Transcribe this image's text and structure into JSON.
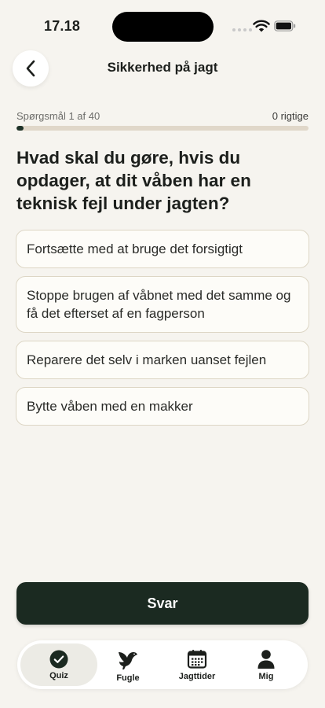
{
  "status_bar": {
    "time": "17.18"
  },
  "header": {
    "title": "Sikkerhed på jagt"
  },
  "progress": {
    "label": "Spørgsmål 1 af 40",
    "score": "0 rigtige",
    "fraction": 0.025
  },
  "question": {
    "text": "Hvad skal du gøre, hvis du opdager, at dit våben har en teknisk fejl under jagten?"
  },
  "answers": [
    {
      "label": "Fortsætte med at bruge det forsigtigt"
    },
    {
      "label": "Stoppe brugen af våbnet med det samme og få det efterset af en fagperson"
    },
    {
      "label": "Reparere det selv i marken uanset fejlen"
    },
    {
      "label": "Bytte våben med en makker"
    }
  ],
  "submit": {
    "label": "Svar"
  },
  "tabs": [
    {
      "label": "Quiz",
      "icon": "check-circle-icon",
      "active": true
    },
    {
      "label": "Fugle",
      "icon": "bird-icon",
      "active": false
    },
    {
      "label": "Jagttider",
      "icon": "calendar-icon",
      "active": false
    },
    {
      "label": "Mig",
      "icon": "person-icon",
      "active": false
    }
  ],
  "colors": {
    "accent": "#1b2a21",
    "background": "#f6f4ef",
    "answer_border": "#ddd6c5"
  }
}
